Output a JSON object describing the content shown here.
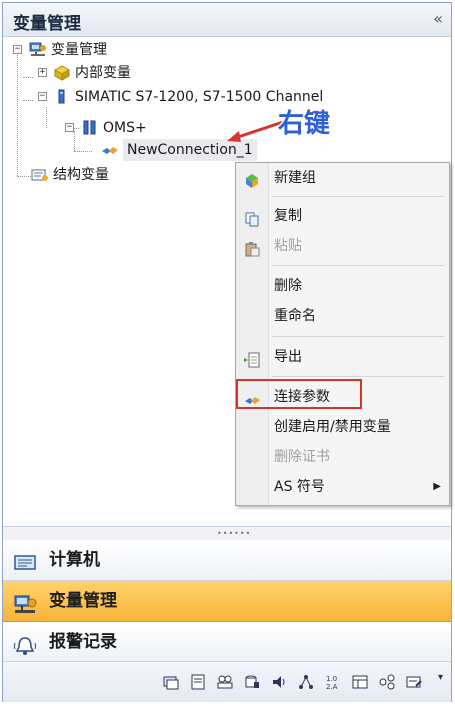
{
  "panel": {
    "title": "变量管理",
    "collapse_glyph": "«"
  },
  "tree": {
    "root": "变量管理",
    "internal": "内部变量",
    "channel": "SIMATIC S7-1200, S7-1500 Channel",
    "oms": "OMS+",
    "connection": "NewConnection_1",
    "struct": "结构变量",
    "expand_minus": "−",
    "expand_plus": "+"
  },
  "annotation": {
    "text": "右键",
    "color": "#2f5fd8",
    "arrow_color": "#d9342b"
  },
  "context_menu": {
    "items": [
      {
        "label": "新建组",
        "icon": "new-group-icon",
        "enabled": true
      },
      {
        "label": "复制",
        "icon": "copy-icon",
        "enabled": true
      },
      {
        "label": "粘贴",
        "icon": "paste-icon",
        "enabled": false
      },
      {
        "label": "删除",
        "icon": "",
        "enabled": true
      },
      {
        "label": "重命名",
        "icon": "",
        "enabled": true
      },
      {
        "label": "导出",
        "icon": "export-icon",
        "enabled": true
      },
      {
        "label": "连接参数",
        "icon": "connection-params-icon",
        "enabled": true,
        "highlighted": true
      },
      {
        "label": "创建启用/禁用变量",
        "icon": "",
        "enabled": true
      },
      {
        "label": "删除证书",
        "icon": "",
        "enabled": false
      },
      {
        "label": "AS 符号",
        "icon": "",
        "enabled": true,
        "submenu": true
      }
    ],
    "submenu_glyph": "▶",
    "highlight_color": "#d9342b"
  },
  "splitter": {
    "grip": "••••••"
  },
  "nav": {
    "panes": [
      {
        "label": "计算机",
        "icon": "computer-icon",
        "active": false
      },
      {
        "label": "变量管理",
        "icon": "tag-management-icon",
        "active": true
      },
      {
        "label": "报警记录",
        "icon": "alarm-bell-icon",
        "active": false
      }
    ],
    "active_color": "#f8b437"
  },
  "toolbar": {
    "icons": [
      "screens-icon",
      "text-list-icon",
      "user-admin-icon",
      "tag-logging-icon",
      "audio-icon",
      "network-icon",
      "numbering-icon",
      "table-icon",
      "connection-icon",
      "report-icon"
    ],
    "more_glyph": "▾"
  }
}
